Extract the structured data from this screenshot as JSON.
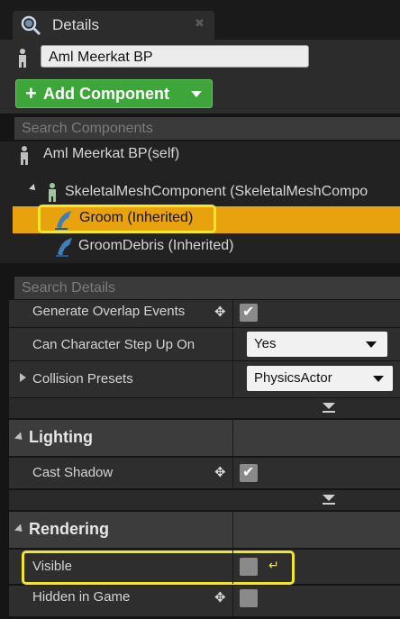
{
  "tab": {
    "title": "Details"
  },
  "name_field": {
    "value": "Aml Meerkat BP"
  },
  "add_component": {
    "label": "Add Component"
  },
  "search_components": {
    "placeholder": "Search Components"
  },
  "tree": {
    "root": "Aml Meerkat BP(self)",
    "skeletal": "SkeletalMeshComponent (SkeletalMeshCompo",
    "groom": "Groom (Inherited)",
    "groom_debris": "GroomDebris (Inherited)"
  },
  "search_details": {
    "placeholder": "Search Details"
  },
  "properties": {
    "generate_overlap": "Generate Overlap Events",
    "can_step_up": "Can Character Step Up On",
    "can_step_up_value": "Yes",
    "collision_presets": "Collision Presets",
    "collision_presets_value": "PhysicsActor"
  },
  "lighting": {
    "title": "Lighting",
    "cast_shadow": "Cast Shadow"
  },
  "rendering": {
    "title": "Rendering",
    "visible": "Visible",
    "hidden_in_game": "Hidden in Game"
  },
  "colors": {
    "accent_green": "#3da53a",
    "selection": "#e8a20e",
    "highlight": "#f3e52b"
  }
}
